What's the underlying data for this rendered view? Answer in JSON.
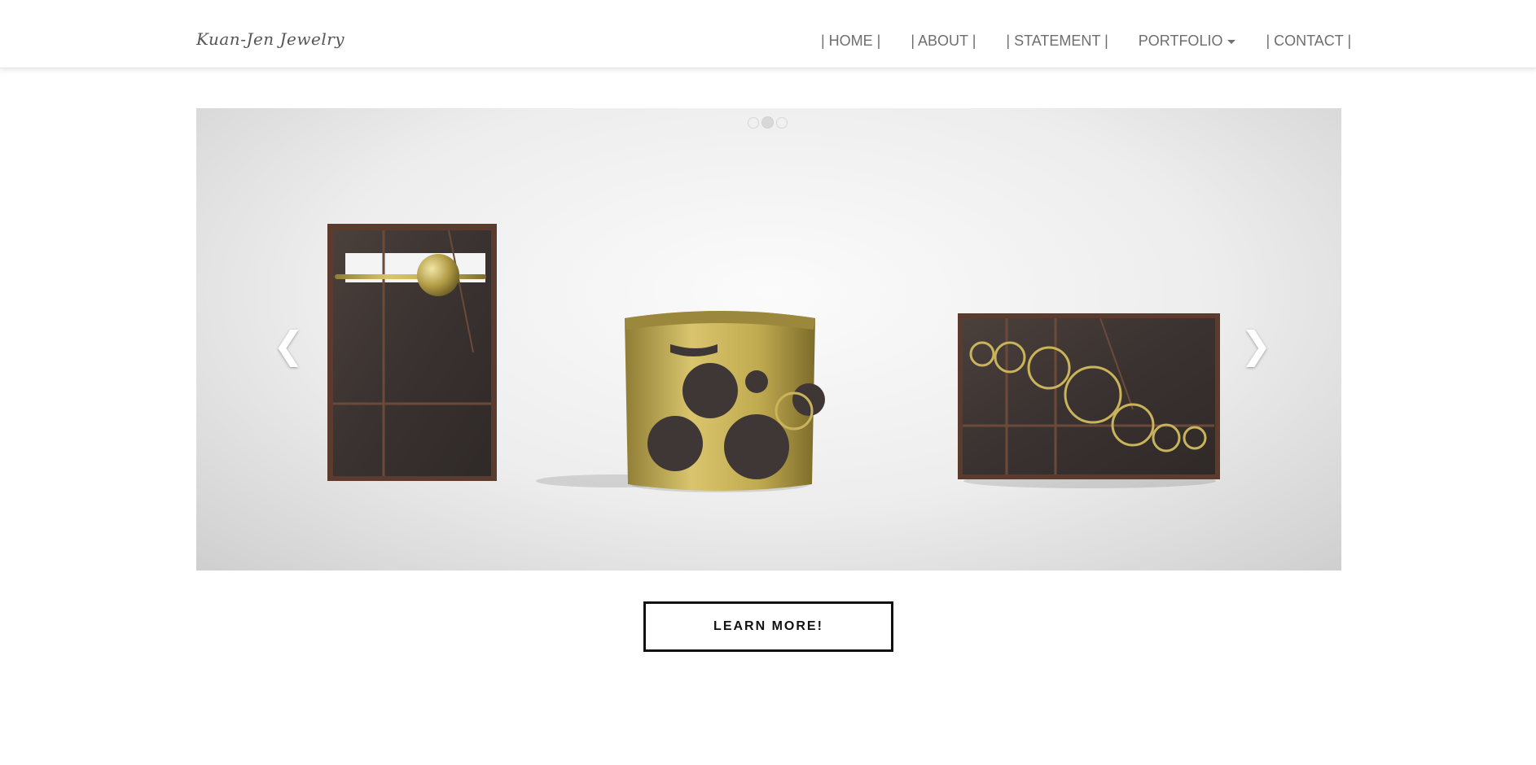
{
  "brand": {
    "name": "Kuan-Jen Jewelry"
  },
  "nav": {
    "items": [
      {
        "label": "| HOME |"
      },
      {
        "label": "| ABOUT |"
      },
      {
        "label": "| STATEMENT |"
      },
      {
        "label": "PORTFOLIO",
        "has_dropdown": true
      },
      {
        "label": "| CONTACT |"
      }
    ]
  },
  "carousel": {
    "slide_count": 3,
    "active_slide": 2,
    "prev_icon": "chevron-left-icon",
    "next_icon": "chevron-right-icon",
    "prev_glyph": "❮",
    "next_glyph": "❯"
  },
  "cta": {
    "label": "LEARN MORE!"
  },
  "colors": {
    "nav_text": "#6e6e6e",
    "button_border": "#111111",
    "brass": "#b9a14a",
    "oxidized_metal": "#3e3734"
  }
}
